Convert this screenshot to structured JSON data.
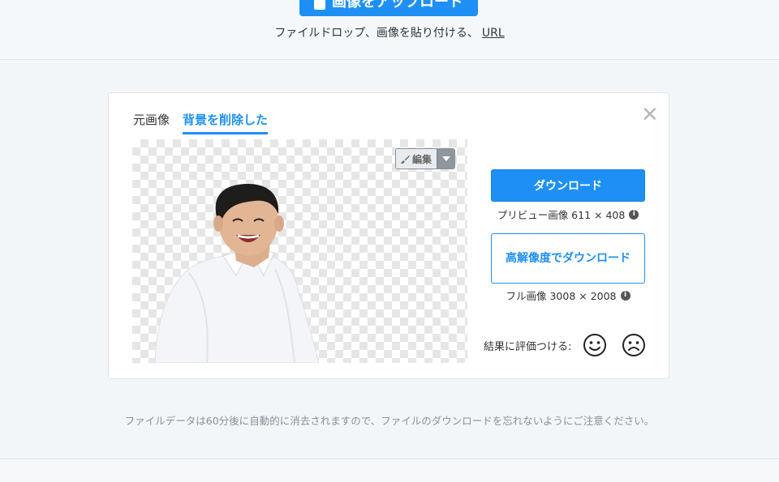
{
  "header": {
    "upload_label": "画像をアップロード",
    "drop_hint": "ファイルドロップ、画像を貼り付ける、",
    "url_label": "URL"
  },
  "card": {
    "tabs": [
      {
        "label": "元画像",
        "active": false
      },
      {
        "label": "背景を削除した",
        "active": true
      }
    ],
    "close_glyph": "✕",
    "edit_label": "編集",
    "download": {
      "label": "ダウンロード",
      "meta": "プリビュー画像 611 × 408"
    },
    "hd_download": {
      "label": "高解像度でダウンロード",
      "meta": "フル画像 3008 × 2008"
    },
    "rating_label": "結果に評価つける:"
  },
  "notice": "ファイルデータは60分後に自動的に消去されますので、ファイルのダウンロードを忘れないようにご注意ください。",
  "colors": {
    "accent": "#1e90f5",
    "page_bg": "#f3f6f8",
    "muted_text": "#8a9099"
  },
  "icons": [
    "image-icon",
    "close-icon",
    "brush-icon",
    "chevron-down-icon",
    "info-icon",
    "smile-icon",
    "frown-icon"
  ]
}
